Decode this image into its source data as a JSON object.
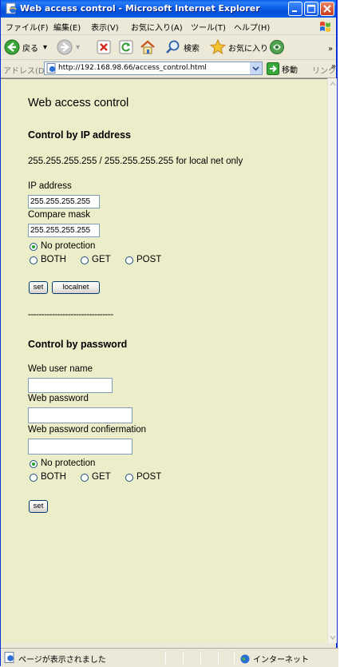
{
  "window": {
    "title": "Web access control - Microsoft Internet Explorer"
  },
  "menu": [
    "ファイル(F)",
    "編集(E)",
    "表示(V)",
    "お気に入り(A)",
    "ツール(T)",
    "ヘルプ(H)"
  ],
  "toolbar": {
    "back_label": "戻る",
    "search_label": "検索",
    "favorites_label": "お気に入り"
  },
  "address": {
    "label": "アドレス(D)",
    "url": "http://192.168.98.66/access_control.html",
    "go_label": "移動",
    "links_label": "リンク"
  },
  "page": {
    "heading": "Web access control",
    "ip_section": {
      "title": "Control by IP address",
      "note": "255.255.255.255 / 255.255.255.255 for local net only",
      "ip_label": "IP address",
      "ip_value": "255.255.255.255",
      "mask_label": "Compare mask",
      "mask_value": "255.255.255.255",
      "radio_no_protection": "No protection",
      "radio_both": "BOTH",
      "radio_get": "GET",
      "radio_post": "POST",
      "set_label": "set",
      "localnet_label": "localnet"
    },
    "separator": "--------------------------------",
    "pw_section": {
      "title": "Control by password",
      "user_label": "Web user name",
      "user_value": "",
      "password_label": "Web password",
      "password_value": "",
      "confirm_label": "Web password confiermation",
      "confirm_value": "",
      "radio_no_protection": "No protection",
      "radio_both": "BOTH",
      "radio_get": "GET",
      "radio_post": "POST",
      "set_label": "set"
    }
  },
  "statusbar": {
    "message": "ページが表示されました",
    "zone": "インターネット"
  },
  "colors": {
    "page_background": "#ecedc9",
    "titlebar": "#0a5ee8",
    "chrome": "#ece9d8"
  }
}
